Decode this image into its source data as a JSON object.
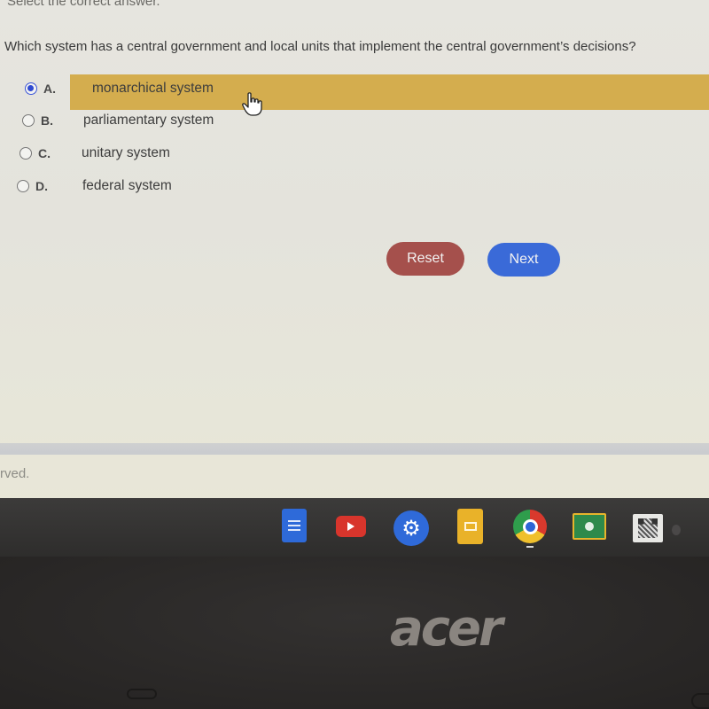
{
  "quiz": {
    "instruction": "Select the correct answer.",
    "question": "Which system has a central government and local units that implement the central government’s decisions?",
    "selected": "A",
    "options": [
      {
        "letter": "A.",
        "text": "monarchical system",
        "selected": true
      },
      {
        "letter": "B.",
        "text": "parliamentary system",
        "selected": false
      },
      {
        "letter": "C.",
        "text": "unitary system",
        "selected": false
      },
      {
        "letter": "D.",
        "text": "federal system",
        "selected": false
      }
    ],
    "buttons": {
      "reset": "Reset",
      "next": "Next"
    }
  },
  "footer": {
    "text": "rved."
  },
  "shelf": {
    "apps": [
      "docs-icon",
      "youtube-icon",
      "settings-icon",
      "slides-icon",
      "chrome-icon",
      "classroom-icon",
      "qr-code-icon"
    ],
    "active_app": "chrome-icon"
  },
  "device": {
    "brand": "acer"
  },
  "colors": {
    "highlight": "#d4ad4e",
    "reset": "#a5504c",
    "next": "#3a6ad8",
    "radio_selected": "#2f4ad1"
  }
}
